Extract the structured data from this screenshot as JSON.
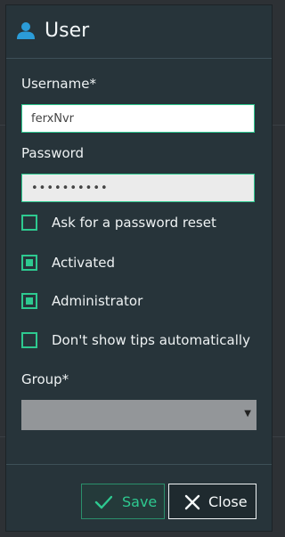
{
  "dialog": {
    "title": "User",
    "title_icon": "user-icon"
  },
  "form": {
    "username": {
      "label": "Username*",
      "value": "ferxNvr"
    },
    "password": {
      "label": "Password",
      "value": "••••••••••"
    },
    "checkboxes": [
      {
        "label": "Ask for a password reset",
        "checked": false
      },
      {
        "label": "Activated",
        "checked": true
      },
      {
        "label": "Administrator",
        "checked": true
      },
      {
        "label": "Don't show tips automatically",
        "checked": false
      }
    ],
    "group": {
      "label": "Group*",
      "selected": ""
    }
  },
  "footer": {
    "save_label": "Save",
    "save_icon": "check-icon",
    "close_label": "Close",
    "close_icon": "close-icon"
  },
  "colors": {
    "accent": "#2ec990",
    "dialog_bg": "#27343a",
    "select_bg": "#939699"
  }
}
